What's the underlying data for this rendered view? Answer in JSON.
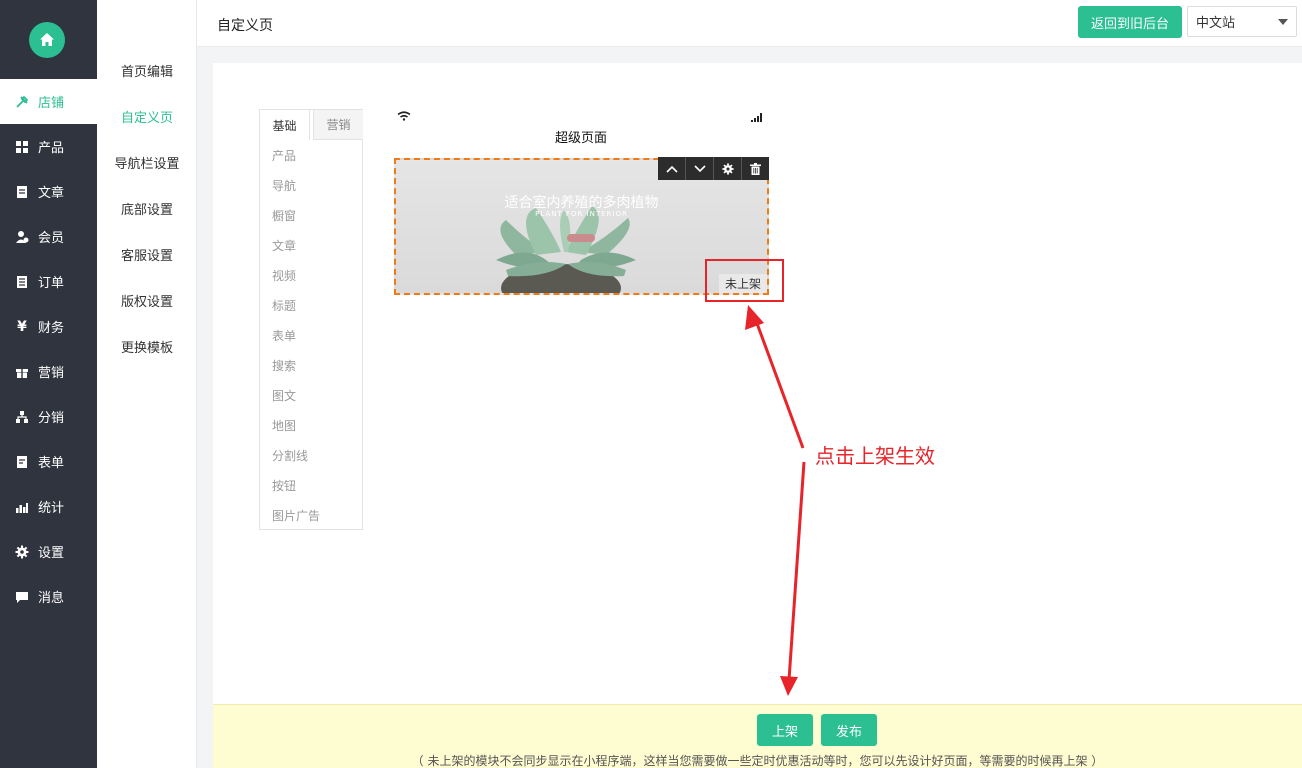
{
  "sidebar": {
    "items": [
      {
        "label": "店铺",
        "icon": "tools-icon"
      },
      {
        "label": "产品",
        "icon": "grid-icon"
      },
      {
        "label": "文章",
        "icon": "document-icon"
      },
      {
        "label": "会员",
        "icon": "member-icon"
      },
      {
        "label": "订单",
        "icon": "list-icon"
      },
      {
        "label": "财务",
        "icon": "yen-icon"
      },
      {
        "label": "营销",
        "icon": "gift-icon"
      },
      {
        "label": "分销",
        "icon": "network-icon"
      },
      {
        "label": "表单",
        "icon": "form-icon"
      },
      {
        "label": "统计",
        "icon": "bar-chart-icon"
      },
      {
        "label": "设置",
        "icon": "gear-icon"
      },
      {
        "label": "消息",
        "icon": "message-icon"
      }
    ],
    "active_index": 0,
    "accent_color": "#2bbf92",
    "background": "#30343f"
  },
  "submenu": {
    "items": [
      "首页编辑",
      "自定义页",
      "导航栏设置",
      "底部设置",
      "客服设置",
      "版权设置",
      "更换模板"
    ],
    "active_index": 1
  },
  "header": {
    "title": "自定义页",
    "back_button": "返回到旧后台",
    "language_select": "中文站"
  },
  "components": {
    "tabs": [
      "基础",
      "营销"
    ],
    "active_tab": 0,
    "items": [
      "产品",
      "导航",
      "橱窗",
      "文章",
      "视频",
      "标题",
      "表单",
      "搜索",
      "图文",
      "地图",
      "分割线",
      "按钮",
      "图片广告"
    ]
  },
  "preview": {
    "page_title": "超级页面",
    "banner_headline": "适合室内养殖的多肉植物",
    "banner_subtitle": "PLANT FOR INTERIOR",
    "module_status": "未上架",
    "toolbar": [
      "move-up-icon",
      "move-down-icon",
      "gear-icon",
      "trash-icon"
    ]
  },
  "annotation": {
    "text": "点击上架生效",
    "color": "#e7242a"
  },
  "footer": {
    "shelve_button": "上架",
    "publish_button": "发布",
    "note": "（ 未上架的模块不会同步显示在小程序端，这样当您需要做一些定时优惠活动等时，您可以先设计好页面，等需要的时候再上架 ）"
  }
}
